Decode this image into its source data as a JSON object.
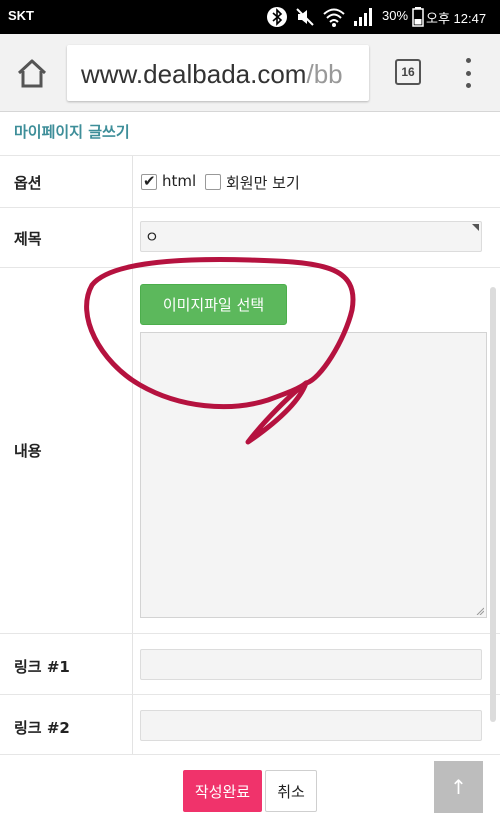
{
  "status_bar": {
    "carrier": "SKT",
    "battery_pct": "30%",
    "time": "오후 12:47"
  },
  "browser": {
    "url_domain": "www.dealbada.com",
    "url_path": "/bb",
    "tab_count": "16"
  },
  "page": {
    "title": "마이페이지 글쓰기",
    "options": {
      "label": "옵션",
      "html_label": "html",
      "html_checked": true,
      "members_only_label": "회원만 보기",
      "members_only_checked": false
    },
    "subject": {
      "label": "제목",
      "value": "ㅇ"
    },
    "content": {
      "label": "내용",
      "image_button": "이미지파일 선택",
      "value": ""
    },
    "link1": {
      "label": "링크 #1",
      "value": ""
    },
    "link2": {
      "label": "링크 #2",
      "value": ""
    },
    "submit_button": "작성완료",
    "cancel_button": "취소",
    "top_button": "↑"
  },
  "colors": {
    "title": "#3e8e99",
    "image_button": "#5cb85c",
    "submit_button": "#f0336b",
    "annotation": "#b5123f"
  }
}
